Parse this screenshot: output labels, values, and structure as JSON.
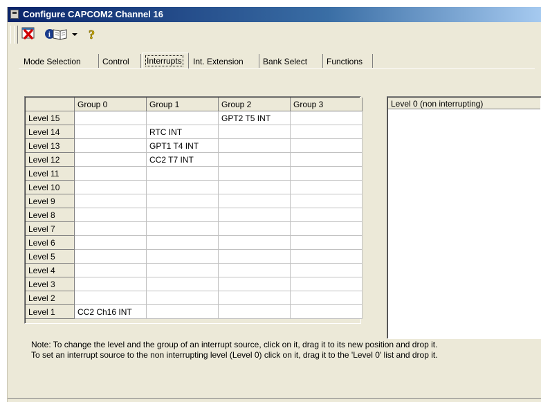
{
  "window": {
    "title": "Configure CAPCOM2 Channel 16"
  },
  "toolbar": {
    "buttons": [
      {
        "icon": "close-red-x-icon"
      },
      {
        "icon": "info-book-icon"
      },
      {
        "icon": "dropdown-arrow-icon"
      },
      {
        "icon": "help-question-icon"
      }
    ]
  },
  "tabs": [
    {
      "label": "Mode Selection",
      "active": false
    },
    {
      "label": "Control",
      "active": false
    },
    {
      "label": "Interrupts",
      "active": true
    },
    {
      "label": "Int. Extension",
      "active": false
    },
    {
      "label": "Bank Select",
      "active": false
    },
    {
      "label": "Functions",
      "active": false
    }
  ],
  "grid": {
    "columns": [
      "Group 0",
      "Group 1",
      "Group 2",
      "Group 3"
    ],
    "rows": [
      {
        "label": "Level 15",
        "cells": [
          "",
          "",
          "GPT2 T5 INT",
          ""
        ]
      },
      {
        "label": "Level 14",
        "cells": [
          "",
          "RTC INT",
          "",
          ""
        ]
      },
      {
        "label": "Level 13",
        "cells": [
          "",
          "GPT1 T4 INT",
          "",
          ""
        ]
      },
      {
        "label": "Level 12",
        "cells": [
          "",
          "CC2 T7 INT",
          "",
          ""
        ]
      },
      {
        "label": "Level 11",
        "cells": [
          "",
          "",
          "",
          ""
        ]
      },
      {
        "label": "Level 10",
        "cells": [
          "",
          "",
          "",
          ""
        ]
      },
      {
        "label": "Level 9",
        "cells": [
          "",
          "",
          "",
          ""
        ]
      },
      {
        "label": "Level 8",
        "cells": [
          "",
          "",
          "",
          ""
        ]
      },
      {
        "label": "Level 7",
        "cells": [
          "",
          "",
          "",
          ""
        ]
      },
      {
        "label": "Level 6",
        "cells": [
          "",
          "",
          "",
          ""
        ]
      },
      {
        "label": "Level 5",
        "cells": [
          "",
          "",
          "",
          ""
        ]
      },
      {
        "label": "Level 4",
        "cells": [
          "",
          "",
          "",
          ""
        ]
      },
      {
        "label": "Level 3",
        "cells": [
          "",
          "",
          "",
          ""
        ]
      },
      {
        "label": "Level 2",
        "cells": [
          "",
          "",
          "",
          ""
        ]
      },
      {
        "label": "Level 1",
        "cells": [
          "CC2 Ch16 INT",
          "",
          "",
          ""
        ]
      }
    ]
  },
  "level0_list": {
    "header": "Level 0 (non interrupting)",
    "items": []
  },
  "note": {
    "line1": "Note: To change the level and the group of an interrupt source, click on it, drag it to its new position and drop it.",
    "line2": "To set an interrupt source to the non interrupting level (Level 0) click on it, drag it to the 'Level 0' list and drop it."
  }
}
